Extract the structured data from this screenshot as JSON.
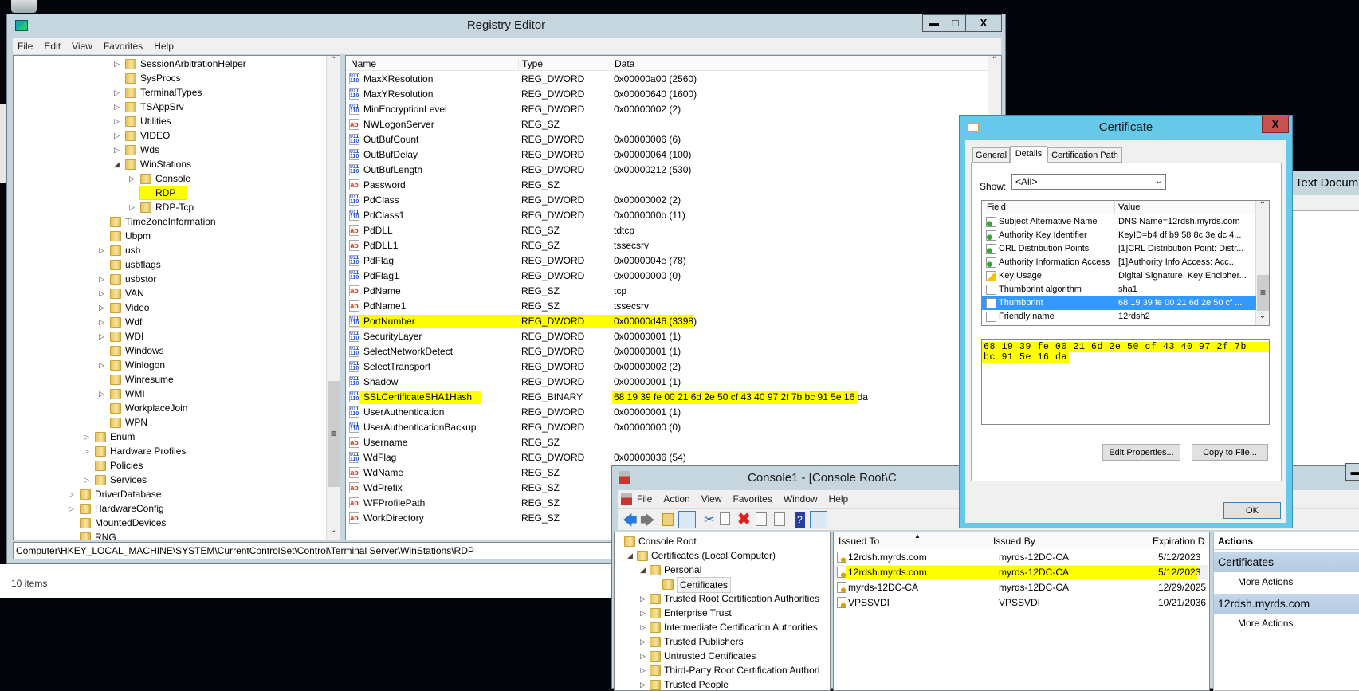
{
  "desktop": {
    "side_window_title": "Text Docum"
  },
  "registry": {
    "title": "Registry Editor",
    "menu": [
      "File",
      "Edit",
      "View",
      "Favorites",
      "Help"
    ],
    "tree": [
      {
        "label": "SessionArbitrationHelper",
        "level": 3,
        "exp": "closed"
      },
      {
        "label": "SysProcs",
        "level": 3,
        "exp": ""
      },
      {
        "label": "TerminalTypes",
        "level": 3,
        "exp": "closed"
      },
      {
        "label": "TSAppSrv",
        "level": 3,
        "exp": "closed"
      },
      {
        "label": "Utilities",
        "level": 3,
        "exp": "closed"
      },
      {
        "label": "VIDEO",
        "level": 3,
        "exp": "closed"
      },
      {
        "label": "Wds",
        "level": 3,
        "exp": "closed"
      },
      {
        "label": "WinStations",
        "level": 3,
        "exp": "open"
      },
      {
        "label": "Console",
        "level": 4,
        "exp": "closed"
      },
      {
        "label": "RDP",
        "level": 4,
        "exp": "",
        "selected": true
      },
      {
        "label": "RDP-Tcp",
        "level": 4,
        "exp": "closed"
      },
      {
        "label": "TimeZoneInformation",
        "level": 2,
        "exp": ""
      },
      {
        "label": "Ubpm",
        "level": 2,
        "exp": ""
      },
      {
        "label": "usb",
        "level": 2,
        "exp": "closed"
      },
      {
        "label": "usbflags",
        "level": 2,
        "exp": ""
      },
      {
        "label": "usbstor",
        "level": 2,
        "exp": "closed"
      },
      {
        "label": "VAN",
        "level": 2,
        "exp": "closed"
      },
      {
        "label": "Video",
        "level": 2,
        "exp": "closed"
      },
      {
        "label": "Wdf",
        "level": 2,
        "exp": "closed"
      },
      {
        "label": "WDI",
        "level": 2,
        "exp": "closed"
      },
      {
        "label": "Windows",
        "level": 2,
        "exp": ""
      },
      {
        "label": "Winlogon",
        "level": 2,
        "exp": "closed"
      },
      {
        "label": "Winresume",
        "level": 2,
        "exp": ""
      },
      {
        "label": "WMI",
        "level": 2,
        "exp": "closed"
      },
      {
        "label": "WorkplaceJoin",
        "level": 2,
        "exp": ""
      },
      {
        "label": "WPN",
        "level": 2,
        "exp": ""
      },
      {
        "label": "Enum",
        "level": 1,
        "exp": "closed"
      },
      {
        "label": "Hardware Profiles",
        "level": 1,
        "exp": "closed"
      },
      {
        "label": "Policies",
        "level": 1,
        "exp": ""
      },
      {
        "label": "Services",
        "level": 1,
        "exp": "closed"
      },
      {
        "label": "DriverDatabase",
        "level": 0,
        "exp": "closed"
      },
      {
        "label": "HardwareConfig",
        "level": 0,
        "exp": "closed"
      },
      {
        "label": "MountedDevices",
        "level": 0,
        "exp": ""
      },
      {
        "label": "RNG",
        "level": 0,
        "exp": ""
      }
    ],
    "columns": {
      "name": "Name",
      "type": "Type",
      "data": "Data"
    },
    "values": [
      {
        "name": "MaxXResolution",
        "type": "REG_DWORD",
        "data": "0x00000a00 (2560)",
        "icon": "bin"
      },
      {
        "name": "MaxYResolution",
        "type": "REG_DWORD",
        "data": "0x00000640 (1600)",
        "icon": "bin"
      },
      {
        "name": "MinEncryptionLevel",
        "type": "REG_DWORD",
        "data": "0x00000002 (2)",
        "icon": "bin"
      },
      {
        "name": "NWLogonServer",
        "type": "REG_SZ",
        "data": "",
        "icon": "sz"
      },
      {
        "name": "OutBufCount",
        "type": "REG_DWORD",
        "data": "0x00000006 (6)",
        "icon": "bin"
      },
      {
        "name": "OutBufDelay",
        "type": "REG_DWORD",
        "data": "0x00000064 (100)",
        "icon": "bin"
      },
      {
        "name": "OutBufLength",
        "type": "REG_DWORD",
        "data": "0x00000212 (530)",
        "icon": "bin"
      },
      {
        "name": "Password",
        "type": "REG_SZ",
        "data": "",
        "icon": "sz"
      },
      {
        "name": "PdClass",
        "type": "REG_DWORD",
        "data": "0x00000002 (2)",
        "icon": "bin"
      },
      {
        "name": "PdClass1",
        "type": "REG_DWORD",
        "data": "0x0000000b (11)",
        "icon": "bin"
      },
      {
        "name": "PdDLL",
        "type": "REG_SZ",
        "data": "tdtcp",
        "icon": "sz"
      },
      {
        "name": "PdDLL1",
        "type": "REG_SZ",
        "data": "tssecsrv",
        "icon": "sz"
      },
      {
        "name": "PdFlag",
        "type": "REG_DWORD",
        "data": "0x0000004e (78)",
        "icon": "bin"
      },
      {
        "name": "PdFlag1",
        "type": "REG_DWORD",
        "data": "0x00000000 (0)",
        "icon": "bin"
      },
      {
        "name": "PdName",
        "type": "REG_SZ",
        "data": "tcp",
        "icon": "sz"
      },
      {
        "name": "PdName1",
        "type": "REG_SZ",
        "data": "tssecsrv",
        "icon": "sz"
      },
      {
        "name": "PortNumber",
        "type": "REG_DWORD",
        "data": "0x00000d46 (3398)",
        "icon": "bin",
        "highlight": "row"
      },
      {
        "name": "SecurityLayer",
        "type": "REG_DWORD",
        "data": "0x00000001 (1)",
        "icon": "bin"
      },
      {
        "name": "SelectNetworkDetect",
        "type": "REG_DWORD",
        "data": "0x00000001 (1)",
        "icon": "bin"
      },
      {
        "name": "SelectTransport",
        "type": "REG_DWORD",
        "data": "0x00000002 (2)",
        "icon": "bin"
      },
      {
        "name": "Shadow",
        "type": "REG_DWORD",
        "data": "0x00000001 (1)",
        "icon": "bin"
      },
      {
        "name": "SSLCertificateSHA1Hash",
        "type": "REG_BINARY",
        "data": "68 19 39 fe 00 21 6d 2e 50 cf 43 40 97 2f 7b bc 91 5e 16 da",
        "icon": "bin",
        "highlight": "split"
      },
      {
        "name": "UserAuthentication",
        "type": "REG_DWORD",
        "data": "0x00000001 (1)",
        "icon": "bin"
      },
      {
        "name": "UserAuthenticationBackup",
        "type": "REG_DWORD",
        "data": "0x00000000 (0)",
        "icon": "bin"
      },
      {
        "name": "Username",
        "type": "REG_SZ",
        "data": "",
        "icon": "sz"
      },
      {
        "name": "WdFlag",
        "type": "REG_DWORD",
        "data": "0x00000036 (54)",
        "icon": "bin"
      },
      {
        "name": "WdName",
        "type": "REG_SZ",
        "data": "",
        "icon": "sz"
      },
      {
        "name": "WdPrefix",
        "type": "REG_SZ",
        "data": "",
        "icon": "sz"
      },
      {
        "name": "WFProfilePath",
        "type": "REG_SZ",
        "data": "",
        "icon": "sz"
      },
      {
        "name": "WorkDirectory",
        "type": "REG_SZ",
        "data": "",
        "icon": "sz"
      }
    ],
    "address": "Computer\\HKEY_LOCAL_MACHINE\\SYSTEM\\CurrentControlSet\\Control\\Terminal Server\\WinStations\\RDP",
    "status": "10 items"
  },
  "certificate": {
    "title": "Certificate",
    "tabs": [
      "General",
      "Details",
      "Certification Path"
    ],
    "active_tab": "Details",
    "show_label": "Show:",
    "show_value": "<All>",
    "columns": {
      "field": "Field",
      "value": "Value"
    },
    "fields": [
      {
        "field": "Subject Alternative Name",
        "value": "DNS Name=12rdsh.myrds.com",
        "icon": "ext"
      },
      {
        "field": "Authority Key Identifier",
        "value": "KeyID=b4 df b9 58 8c 3e dc 4...",
        "icon": "ext"
      },
      {
        "field": "CRL Distribution Points",
        "value": "[1]CRL Distribution Point: Distr...",
        "icon": "ext"
      },
      {
        "field": "Authority Information Access",
        "value": "[1]Authority Info Access: Acc...",
        "icon": "ext"
      },
      {
        "field": "Key Usage",
        "value": "Digital Signature, Key Encipher...",
        "icon": "warn"
      },
      {
        "field": "Thumbprint algorithm",
        "value": "sha1",
        "icon": "prop"
      },
      {
        "field": "Thumbprint",
        "value": "68 19 39 fe 00 21 6d 2e 50 cf ...",
        "icon": "prop",
        "selected": true
      },
      {
        "field": "Friendly name",
        "value": "12rdsh2",
        "icon": "prop"
      }
    ],
    "detail_lines": [
      "68 19 39 fe 00 21 6d 2e 50 cf 43 40 97 2f 7b",
      "bc 91 5e 16 da"
    ],
    "edit_properties": "Edit Properties...",
    "copy_to_file": "Copy to File...",
    "ok": "OK"
  },
  "console": {
    "title": "Console1 - [Console Root\\C",
    "menu": [
      "File",
      "Action",
      "View",
      "Favorites",
      "Window",
      "Help"
    ],
    "tree": [
      {
        "label": "Console Root",
        "level": 0,
        "exp": ""
      },
      {
        "label": "Certificates (Local Computer)",
        "level": 1,
        "exp": "open"
      },
      {
        "label": "Personal",
        "level": 2,
        "exp": "open"
      },
      {
        "label": "Certificates",
        "level": 3,
        "exp": "",
        "selected": true
      },
      {
        "label": "Trusted Root Certification Authorities",
        "level": 2,
        "exp": "closed"
      },
      {
        "label": "Enterprise Trust",
        "level": 2,
        "exp": "closed"
      },
      {
        "label": "Intermediate Certification Authorities",
        "level": 2,
        "exp": "closed"
      },
      {
        "label": "Trusted Publishers",
        "level": 2,
        "exp": "closed"
      },
      {
        "label": "Untrusted Certificates",
        "level": 2,
        "exp": "closed"
      },
      {
        "label": "Third-Party Root Certification Authori",
        "level": 2,
        "exp": "closed"
      },
      {
        "label": "Trusted People",
        "level": 2,
        "exp": "closed"
      }
    ],
    "columns": {
      "issued_to": "Issued To",
      "issued_by": "Issued By",
      "expiration": "Expiration D"
    },
    "rows": [
      {
        "issued_to": "12rdsh.myrds.com",
        "issued_by": "myrds-12DC-CA",
        "expiration": "5/12/2023"
      },
      {
        "issued_to": "12rdsh.myrds.com",
        "issued_by": "myrds-12DC-CA",
        "expiration": "5/12/2023",
        "highlight": true
      },
      {
        "issued_to": "myrds-12DC-CA",
        "issued_by": "myrds-12DC-CA",
        "expiration": "12/29/2025"
      },
      {
        "issued_to": "VPSSVDI",
        "issued_by": "VPSSVDI",
        "expiration": "10/21/2036"
      }
    ],
    "actions": {
      "header": "Actions",
      "groups": [
        {
          "title": "Certificates",
          "item": "More Actions"
        },
        {
          "title": "12rdsh.myrds.com",
          "item": "More Actions"
        }
      ]
    }
  },
  "colors": {
    "highlight": "#ffff00",
    "selection": "#3399ff",
    "cert_titlebar": "#66c9ea",
    "close": "#c75050",
    "frame": "#c5d6de"
  }
}
